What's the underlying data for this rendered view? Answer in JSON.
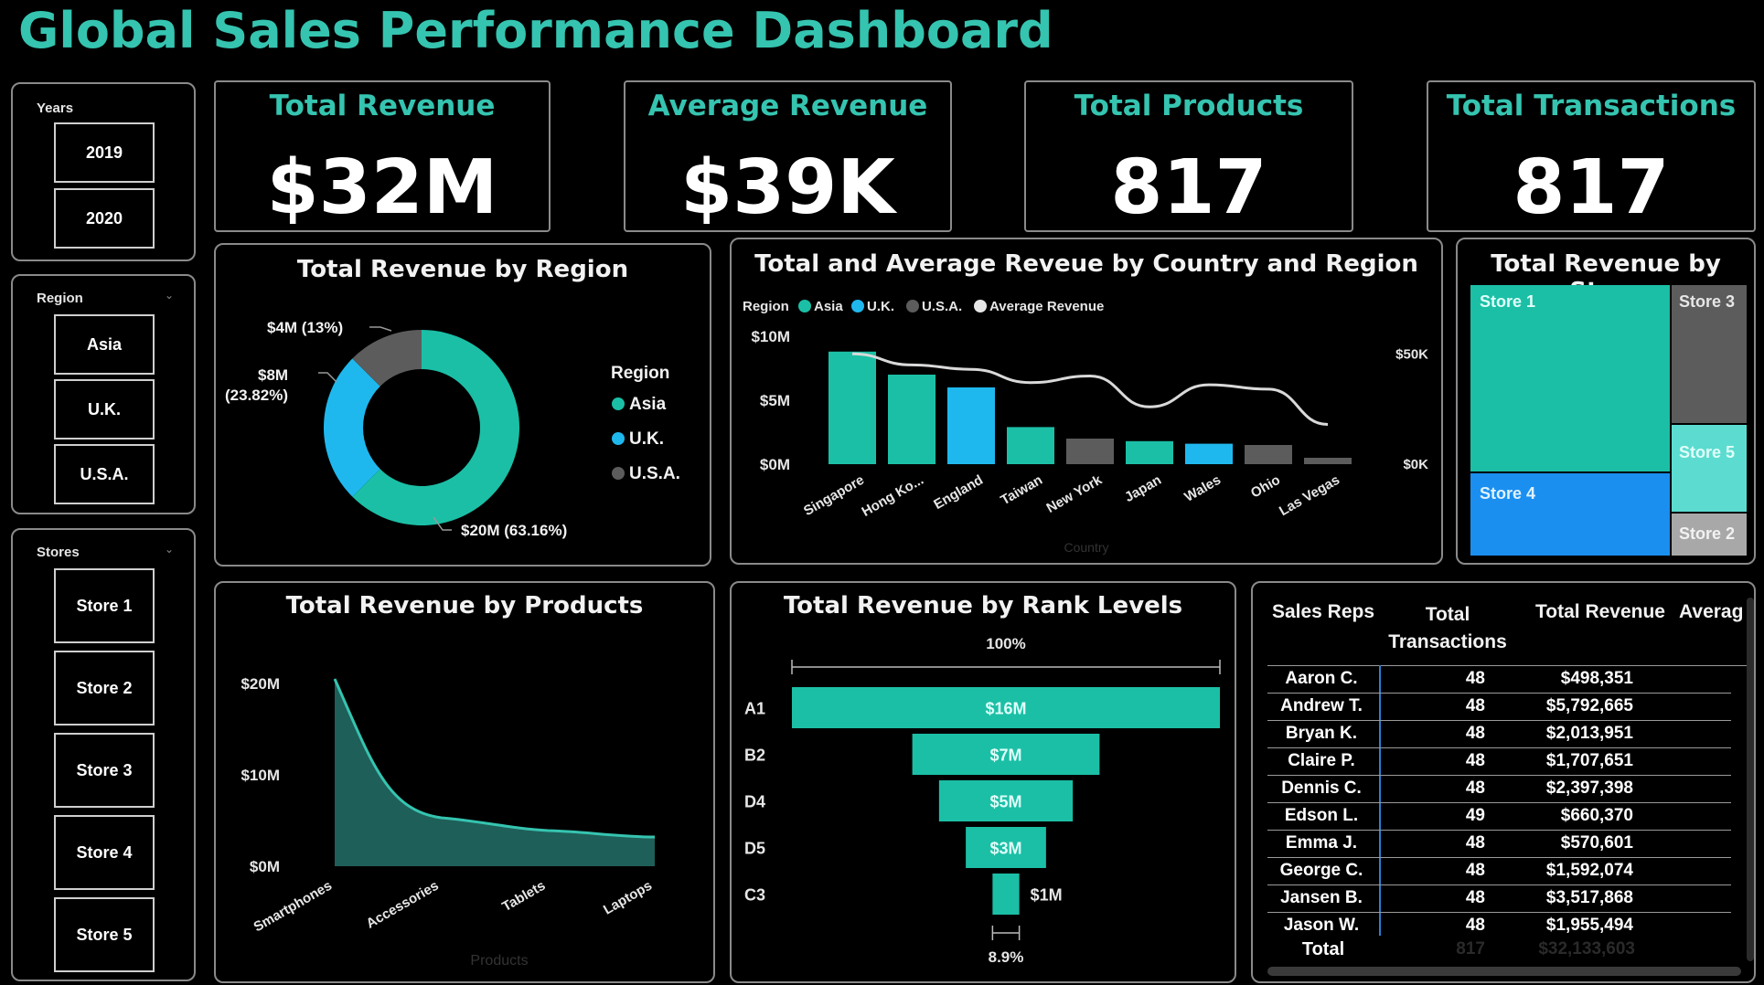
{
  "title": "Global Sales Performance Dashboard",
  "slicers": {
    "years": {
      "label": "Years",
      "items": [
        "2019",
        "2020"
      ]
    },
    "region": {
      "label": "Region",
      "items": [
        "Asia",
        "U.K.",
        "U.S.A."
      ]
    },
    "stores": {
      "label": "Stores",
      "items": [
        "Store 1",
        "Store 2",
        "Store 3",
        "Store 4",
        "Store 5"
      ]
    }
  },
  "kpis": [
    {
      "label": "Total Revenue",
      "value": "$32M"
    },
    {
      "label": "Average Revenue",
      "value": "$39K"
    },
    {
      "label": "Total Products",
      "value": "817"
    },
    {
      "label": "Total Transactions",
      "value": "817"
    }
  ],
  "colors": {
    "asia": "#1bbfa6",
    "uk": "#1fb8ee",
    "usa": "#5c5c5c",
    "accent": "#35c4b0",
    "line": "#d9d9d9"
  },
  "chart_data": [
    {
      "type": "pie",
      "title": "Total Revenue by Region",
      "legend_title": "Region",
      "legend_position": "right",
      "categories": [
        "Asia",
        "U.K.",
        "U.S.A."
      ],
      "values": [
        20,
        8,
        4
      ],
      "labels": [
        "$20M (63.16%)",
        "$8M (23.82%)",
        "$4M (13%)"
      ]
    },
    {
      "type": "bar",
      "title": "Total and Average Reveue by Country and Region",
      "legend_title": "Region",
      "legend": [
        "Asia",
        "U.K.",
        "U.S.A.",
        "Average Revenue"
      ],
      "legend_position": "top-left",
      "categories": [
        "Singapore",
        "Hong Ko...",
        "England",
        "Taiwan",
        "New York",
        "Japan",
        "Wales",
        "Ohio",
        "Las Vegas"
      ],
      "regions": [
        "Asia",
        "Asia",
        "U.K.",
        "Asia",
        "U.S.A.",
        "Asia",
        "U.K.",
        "U.S.A.",
        "U.S.A."
      ],
      "values": [
        8.8,
        7.0,
        6.0,
        2.9,
        2.0,
        1.8,
        1.6,
        1.5,
        0.5
      ],
      "average_revenue": [
        50,
        45,
        43,
        37,
        40,
        26,
        36,
        34,
        18
      ],
      "ylim": [
        0,
        10
      ],
      "y_ticks": [
        "$0M",
        "$5M",
        "$10M"
      ],
      "y2lim": [
        0,
        58
      ],
      "y2_ticks": [
        "$0K",
        "$50K"
      ],
      "xlabel": "Country"
    },
    {
      "type": "treemap",
      "title": "Total Revenue by Store",
      "labels": [
        "Store 1",
        "Store 3",
        "Store 5",
        "Store 4",
        "Store 2"
      ]
    },
    {
      "type": "area",
      "title": "Total Revenue by Products",
      "categories": [
        "Smartphones",
        "Accessories",
        "Tablets",
        "Laptops"
      ],
      "values": [
        20.5,
        5.3,
        3.9,
        3.2
      ],
      "y_ticks": [
        "$0M",
        "$10M",
        "$20M"
      ],
      "ylim": [
        0,
        21
      ],
      "xlabel": "Products"
    },
    {
      "type": "bar",
      "title": "Total Revenue by Rank Levels",
      "orientation": "funnel",
      "categories": [
        "A1",
        "B2",
        "D4",
        "D5",
        "C3"
      ],
      "values": [
        16,
        7,
        5,
        3,
        1
      ],
      "labels": [
        "$16M",
        "$7M",
        "$5M",
        "$3M",
        "$1M"
      ],
      "top_percent": "100%",
      "bottom_percent": "8.9%"
    }
  ],
  "table": {
    "headers": [
      "Sales Reps",
      "Total Transactions",
      "Total Revenue",
      "Averag"
    ],
    "rows": [
      [
        "Aaron C.",
        "48",
        "$498,351"
      ],
      [
        "Andrew T.",
        "48",
        "$5,792,665"
      ],
      [
        "Bryan K.",
        "48",
        "$2,013,951"
      ],
      [
        "Claire P.",
        "48",
        "$1,707,651"
      ],
      [
        "Dennis C.",
        "48",
        "$2,397,398"
      ],
      [
        "Edson L.",
        "49",
        "$660,370"
      ],
      [
        "Emma J.",
        "48",
        "$570,601"
      ],
      [
        "George C.",
        "48",
        "$1,592,074"
      ],
      [
        "Jansen B.",
        "48",
        "$3,517,868"
      ],
      [
        "Jason W.",
        "48",
        "$1,955,494"
      ]
    ],
    "total_label": "Total",
    "total_transactions": "817",
    "total_revenue": "$32,133,603"
  }
}
